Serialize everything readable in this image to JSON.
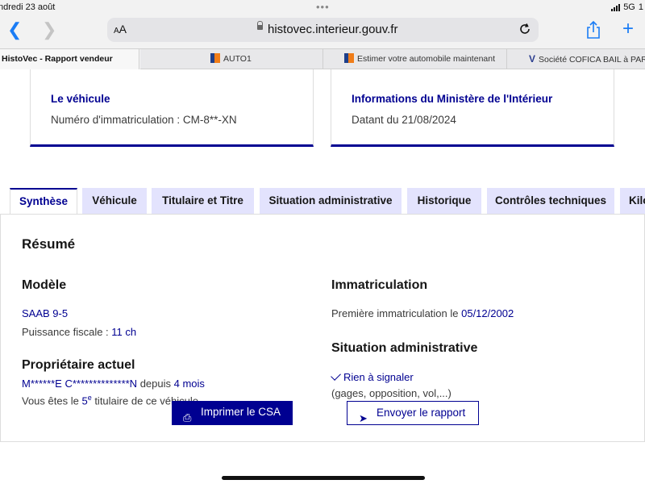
{
  "status": {
    "time": "ndredi 23 août",
    "network": "5G",
    "battery": "1"
  },
  "toolbar": {
    "aa": "AA",
    "url": "histovec.interieur.gouv.fr"
  },
  "browser_tabs": [
    {
      "label": "HistoVec - Rapport vendeur"
    },
    {
      "label": "AUTO1"
    },
    {
      "label": "Estimer votre automobile maintenant"
    },
    {
      "label": "Société COFICA BAIL à PARIS"
    }
  ],
  "cards": {
    "vehicle": {
      "title": "Le véhicule",
      "text": "Numéro d'immatriculation : CM-8**-XN"
    },
    "ministry": {
      "title": "Informations du Ministère de l'Intérieur",
      "text": "Datant du 21/08/2024"
    }
  },
  "tabs": [
    "Synthèse",
    "Véhicule",
    "Titulaire et Titre",
    "Situation administrative",
    "Historique",
    "Contrôles techniques",
    "Kilométrage"
  ],
  "summary": {
    "heading": "Résumé",
    "model": {
      "heading": "Modèle",
      "name": "SAAB 9-5",
      "power_label": "Puissance fiscale : ",
      "power_value": "11 ch"
    },
    "owner": {
      "heading": "Propriétaire actuel",
      "name": "M******E C**************N",
      "since_label": " depuis ",
      "since_value": "4 mois",
      "rank_prefix": "Vous êtes le ",
      "rank_num": "5",
      "rank_sup": "e",
      "rank_suffix": " titulaire de ce véhicule"
    },
    "registration": {
      "heading": "Immatriculation",
      "first_label": "Première immatriculation le ",
      "first_date": "05/12/2002"
    },
    "admin": {
      "heading": "Situation administrative",
      "status": "Rien à signaler",
      "detail": "(gages, opposition, vol,...)"
    }
  },
  "buttons": {
    "print": "Imprimer le CSA",
    "send": "Envoyer le rapport"
  },
  "colors": {
    "accent": "#000091",
    "tab_bg": "#e3e3fd",
    "ios_blue": "#1a7cf5"
  }
}
